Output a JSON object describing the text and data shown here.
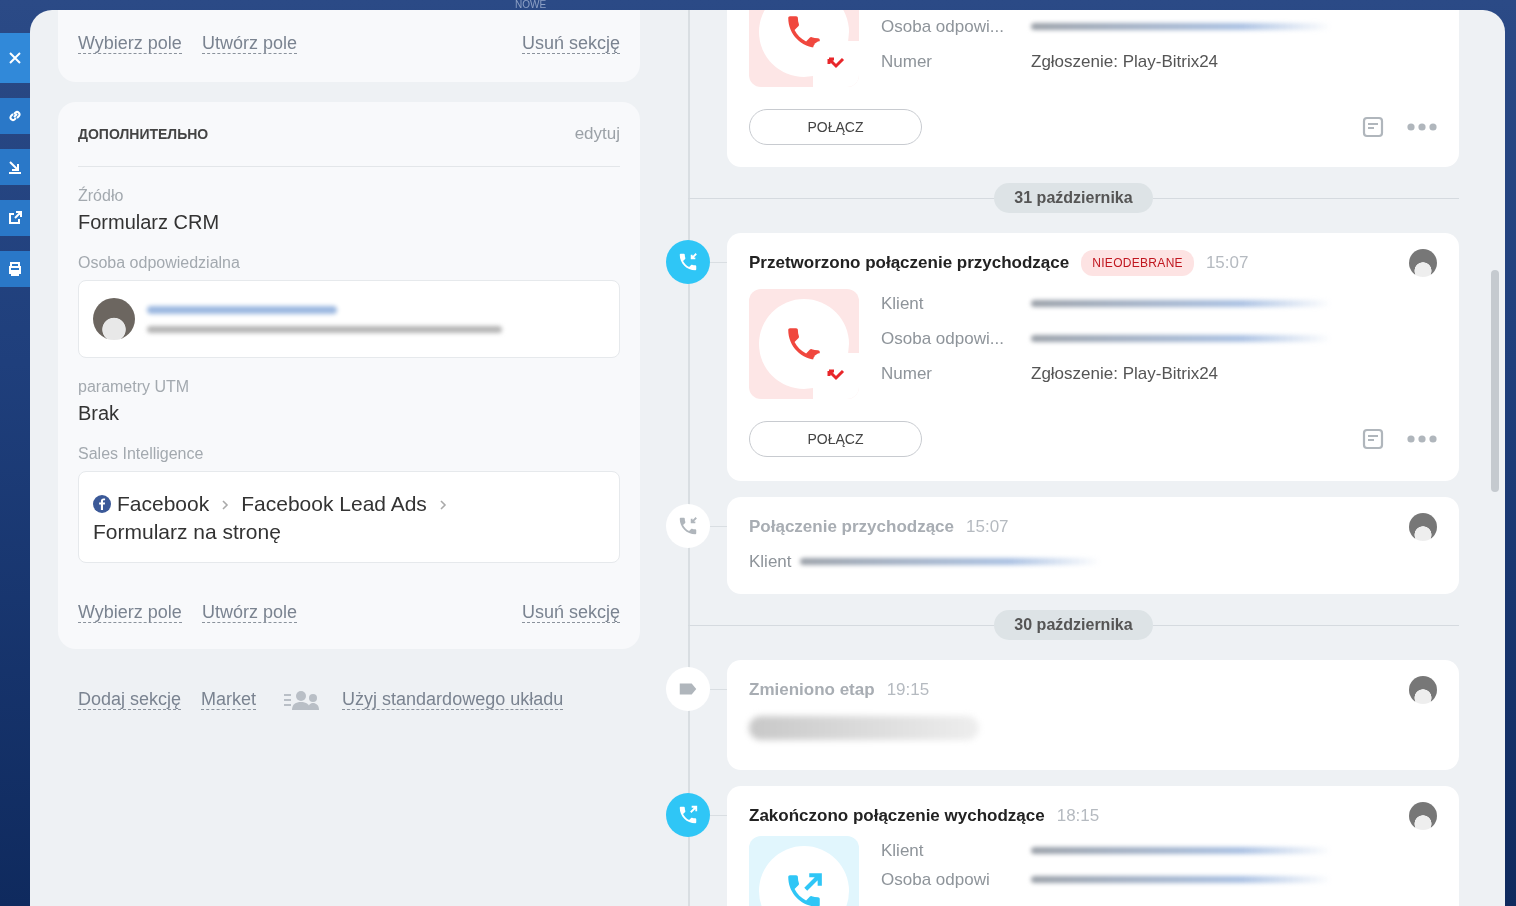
{
  "top_label": "NOWE",
  "left": {
    "upper_section": {
      "actions": [
        "Wybierz pole",
        "Utwórz pole",
        "Usuń sekcję"
      ]
    },
    "section": {
      "title": "ДОПОЛНИТЕЛЬНО",
      "edit": "edytuj",
      "fields": [
        {
          "kind": "text",
          "label": "Źródło",
          "value": "Formularz CRM"
        },
        {
          "kind": "user",
          "label": "Osoba odpowiedzialna"
        },
        {
          "kind": "text",
          "label": "parametry UTM",
          "value": "Brak"
        },
        {
          "kind": "path",
          "label": "Sales Intelligence",
          "steps": [
            "Facebook",
            "Facebook Lead Ads",
            "Formularz na stronę"
          ]
        }
      ],
      "actions": [
        "Wybierz pole",
        "Utwórz pole",
        "Usuń sekcję"
      ]
    },
    "footer_links": [
      {
        "kind": "link",
        "label": "Dodaj sekcję"
      },
      {
        "kind": "link",
        "label": "Market"
      },
      {
        "kind": "layout",
        "label": "Użyj standardowego układu"
      }
    ]
  },
  "timeline": [
    {
      "kind": "missed_call",
      "cut_top": true,
      "rows": [
        {
          "label": "Osoba odpowi..."
        },
        {
          "label": "Numer",
          "value": "Zgłoszenie: Play-Bitrix24"
        }
      ],
      "button": "POŁĄCZ"
    },
    {
      "kind": "date",
      "label": "31 października"
    },
    {
      "kind": "missed_call",
      "cut_top": false,
      "highlighted": true,
      "title": "Przetworzono połączenie przychodzące",
      "badge": "NIEODEBRANE",
      "time": "15:07",
      "rows": [
        {
          "label": "Klient"
        },
        {
          "label": "Osoba odpowi..."
        },
        {
          "label": "Numer",
          "value": "Zgłoszenie: Play-Bitrix24"
        }
      ],
      "button": "POŁĄCZ"
    },
    {
      "kind": "incoming_call",
      "highlighted": false,
      "title": "Połączenie przychodzące",
      "time": "15:07",
      "rows": [
        {
          "label": "Klient"
        }
      ]
    },
    {
      "kind": "date",
      "label": "30 października"
    },
    {
      "kind": "stage_change",
      "highlighted": false,
      "title": "Zmieniono etap",
      "time": "19:15"
    },
    {
      "kind": "outgoing_call",
      "highlighted": true,
      "title": "Zakończono połączenie wychodzące",
      "time": "18:15",
      "rows": [
        {
          "label": "Klient"
        },
        {
          "label": "Osoba odpowi"
        }
      ]
    }
  ]
}
